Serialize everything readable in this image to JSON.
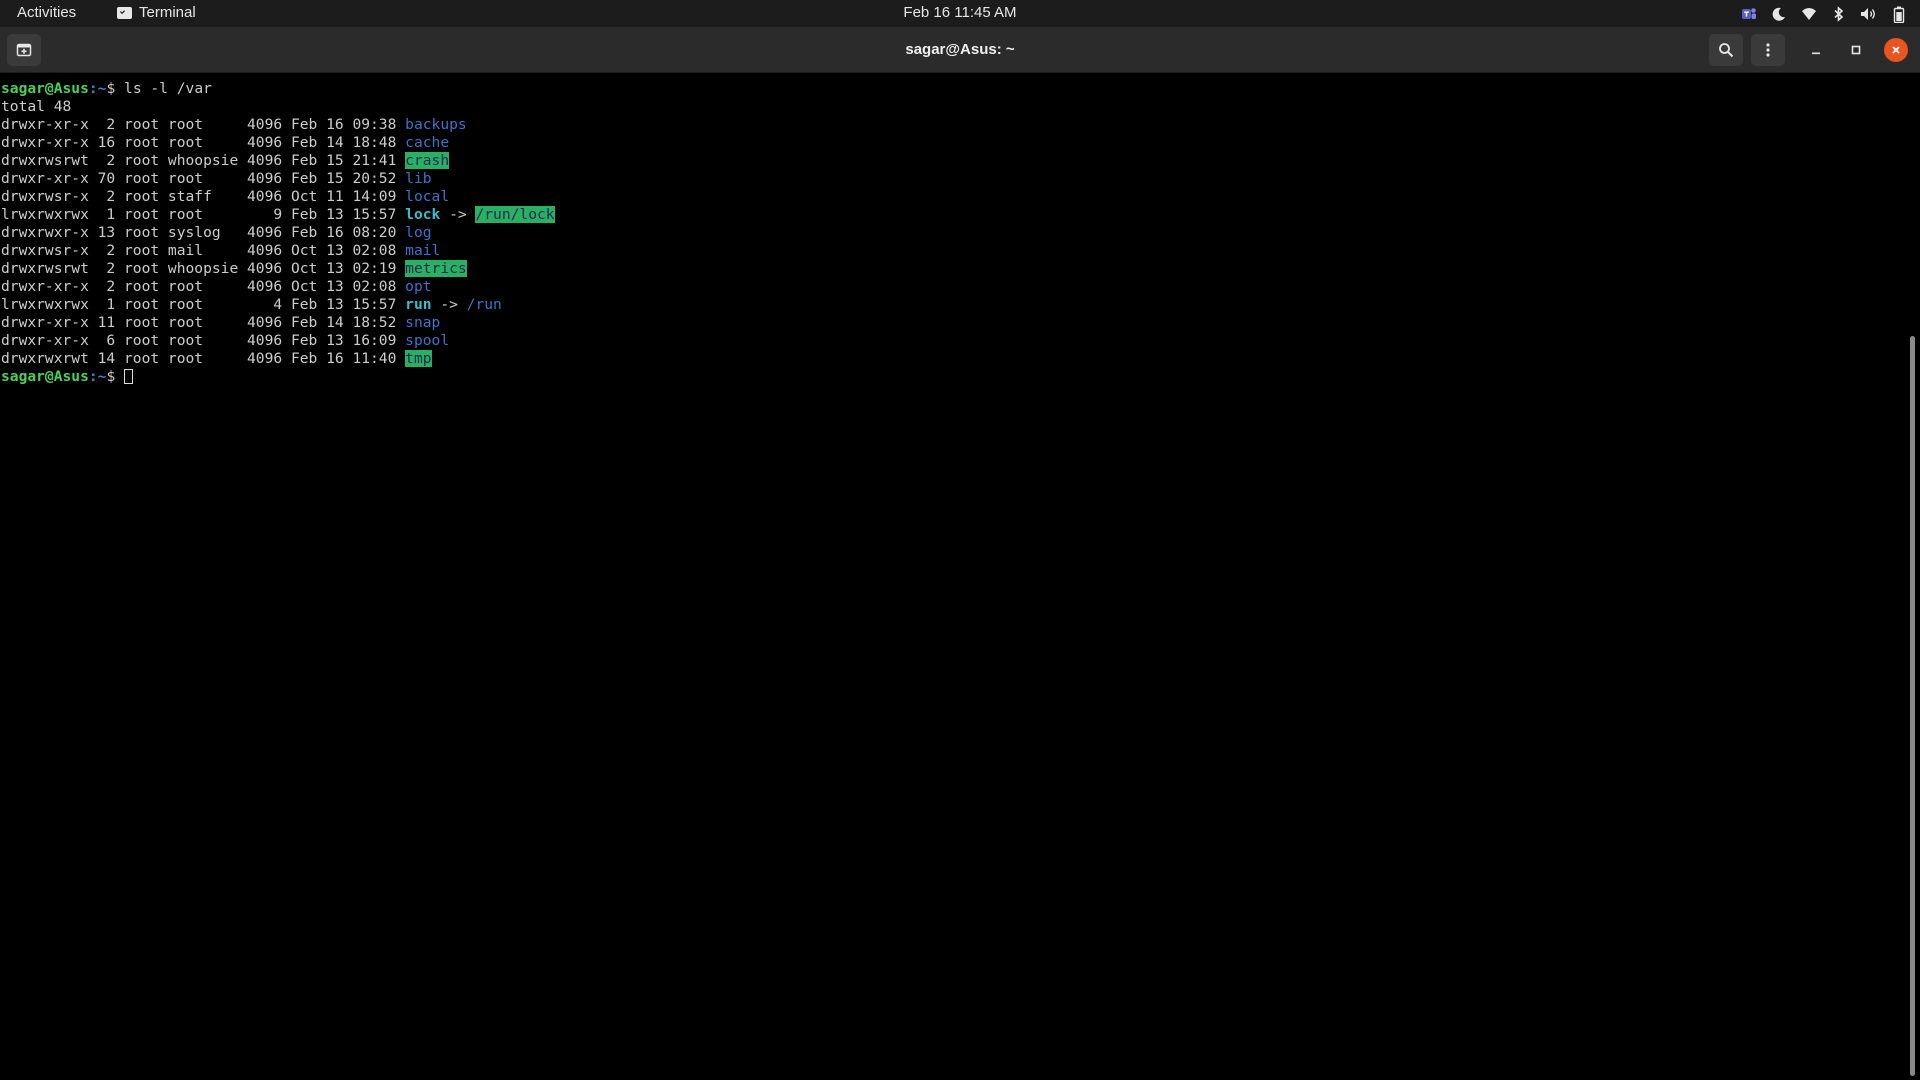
{
  "topbar": {
    "activities": "Activities",
    "app_name": "Terminal",
    "clock": "Feb 16  11:45 AM",
    "tray_icons": [
      "teams-icon",
      "night-light-icon",
      "wifi-icon",
      "bluetooth-icon",
      "volume-icon",
      "battery-icon"
    ]
  },
  "window": {
    "title": "sagar@Asus: ~",
    "buttons": [
      "new-tab-icon",
      "search-icon",
      "menu-icon",
      "minimize-icon",
      "maximize-icon",
      "close-icon"
    ]
  },
  "colors": {
    "prompt_user": "#4cd05a",
    "prompt_path": "#4a7ecf",
    "directory": "#3f72c8",
    "symlink": "#34bfd0",
    "sticky_bg": "#29b063",
    "close_button": "#e95420"
  },
  "terminal": {
    "prompt_user": "sagar@Asus",
    "prompt_path": ":~",
    "prompt_symbol": "$ ",
    "command": "ls -l /var",
    "total": "total 48",
    "entries": [
      {
        "meta": "drwxr-xr-x  2 root root     4096 Feb 16 09:38 ",
        "name": "backups",
        "kind": "dir"
      },
      {
        "meta": "drwxr-xr-x 16 root root     4096 Feb 14 18:48 ",
        "name": "cache",
        "kind": "dir"
      },
      {
        "meta": "drwxrwsrwt  2 root whoopsie 4096 Feb 15 21:41 ",
        "name": "crash",
        "kind": "sticky"
      },
      {
        "meta": "drwxr-xr-x 70 root root     4096 Feb 15 20:52 ",
        "name": "lib",
        "kind": "dir"
      },
      {
        "meta": "drwxrwsr-x  2 root staff    4096 Oct 11 14:09 ",
        "name": "local",
        "kind": "dir"
      },
      {
        "meta": "lrwxrwxrwx  1 root root        9 Feb 13 15:57 ",
        "name": "lock",
        "kind": "link",
        "arrow": " -> ",
        "target": "/run/lock",
        "target_kind": "sticky"
      },
      {
        "meta": "drwxrwxr-x 13 root syslog   4096 Feb 16 08:20 ",
        "name": "log",
        "kind": "dir"
      },
      {
        "meta": "drwxrwsr-x  2 root mail     4096 Oct 13 02:08 ",
        "name": "mail",
        "kind": "dir"
      },
      {
        "meta": "drwxrwsrwt  2 root whoopsie 4096 Oct 13 02:19 ",
        "name": "metrics",
        "kind": "sticky"
      },
      {
        "meta": "drwxr-xr-x  2 root root     4096 Oct 13 02:08 ",
        "name": "opt",
        "kind": "dir"
      },
      {
        "meta": "lrwxrwxrwx  1 root root        4 Feb 13 15:57 ",
        "name": "run",
        "kind": "link",
        "arrow": " -> ",
        "target": "/run",
        "target_kind": "dir"
      },
      {
        "meta": "drwxr-xr-x 11 root root     4096 Feb 14 18:52 ",
        "name": "snap",
        "kind": "dir"
      },
      {
        "meta": "drwxr-xr-x  6 root root     4096 Feb 13 16:09 ",
        "name": "spool",
        "kind": "dir"
      },
      {
        "meta": "drwxrwxrwt 14 root root     4096 Feb 16 11:40 ",
        "name": "tmp",
        "kind": "sticky"
      }
    ]
  }
}
